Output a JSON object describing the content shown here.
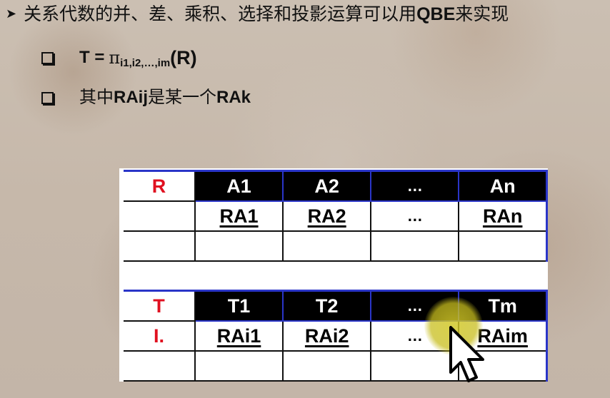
{
  "heading": {
    "bullet_icon": "arrow-bullet-icon",
    "text_prefix": "关系代数的并、差、乘积、选择和投影运算可以用",
    "text_bold": "QBE",
    "text_suffix": "来实现"
  },
  "bullets": [
    {
      "icon": "checkbox-bullet-icon",
      "lead": "T = ",
      "pi": "π",
      "subscript": "i1,i2,…,im",
      "arg": "(R)"
    },
    {
      "icon": "checkbox-bullet-icon",
      "prefix": "其中",
      "term1": "RAij",
      "middle": " 是某一个",
      "term2": "RAk"
    }
  ],
  "table_r": {
    "relation": "R",
    "headers": [
      "A1",
      "A2",
      "…",
      "An"
    ],
    "example_row": [
      "RA1",
      "RA2",
      "…",
      "RAn"
    ]
  },
  "table_t": {
    "relation": "T",
    "row_label": "I.",
    "headers": [
      "T1",
      "T2",
      "…",
      "Tm"
    ],
    "example_row": [
      "RAi1",
      "RAi2",
      "…",
      "RAim"
    ]
  },
  "colors": {
    "relation_red": "#e01020",
    "header_bg": "#000000",
    "header_border": "#2a35c8",
    "cursor_highlight": "#d2c828"
  },
  "cursor": {
    "icon": "mouse-pointer-icon"
  }
}
